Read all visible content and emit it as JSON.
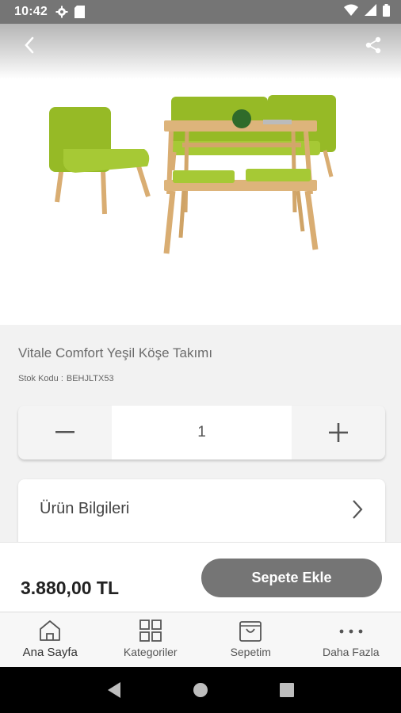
{
  "status_bar": {
    "time": "10:42",
    "icons": [
      "gear-icon",
      "sd-card-icon",
      "wifi-icon",
      "signal-icon",
      "battery-icon"
    ]
  },
  "header": {
    "back_icon": "chevron-left-icon",
    "share_icon": "share-icon"
  },
  "product": {
    "title": "Vitale Comfort Yeşil Köşe Takımı",
    "stock_label": "Stok Kodu :",
    "stock_code": "BEHJLTX53",
    "image": "green-corner-dining-set-image",
    "colors": {
      "upholstery": "#9cbf2a",
      "wood": "#d9ad72"
    }
  },
  "quantity": {
    "value": "1",
    "minus_icon": "minus-icon",
    "plus_icon": "plus-icon"
  },
  "info_card": {
    "label": "Ürün Bilgileri"
  },
  "cart": {
    "price": "3.880,00 TL",
    "add_label": "Sepete Ekle"
  },
  "tabs": [
    {
      "label": "Ana Sayfa",
      "icon": "home-icon",
      "active": true
    },
    {
      "label": "Kategoriler",
      "icon": "grid-icon",
      "active": false
    },
    {
      "label": "Sepetim",
      "icon": "shopping-bag-icon",
      "active": false
    },
    {
      "label": "Daha Fazla",
      "icon": "more-dots-icon",
      "active": false
    }
  ],
  "colors": {
    "status_bar": "#757575",
    "add_button": "#757575",
    "background": "#f2f2f2"
  }
}
